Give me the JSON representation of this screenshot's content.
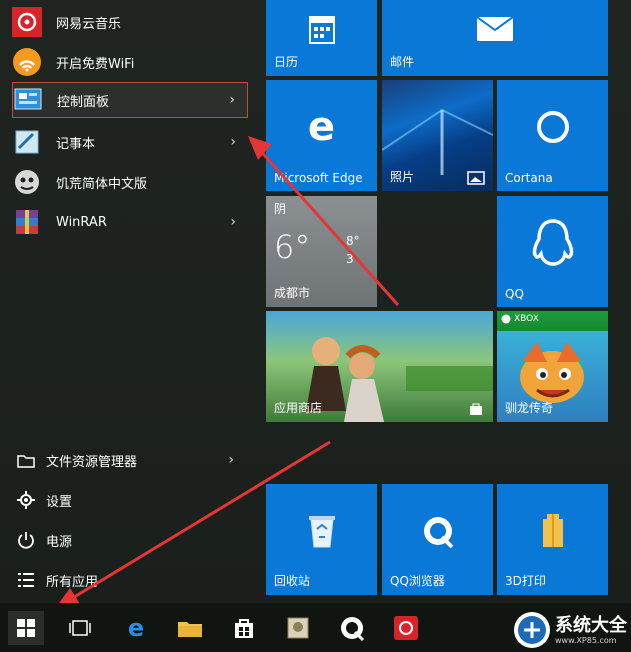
{
  "apps": [
    {
      "label": "网易云音乐",
      "icon": "netease-music-icon"
    },
    {
      "label": "开启免费WiFi",
      "icon": "free-wifi-icon"
    },
    {
      "label": "控制面板",
      "icon": "control-panel-icon"
    },
    {
      "label": "记事本",
      "icon": "notepad-icon"
    },
    {
      "label": "饥荒简体中文版",
      "icon": "dont-starve-icon"
    },
    {
      "label": "WinRAR",
      "icon": "winrar-icon"
    }
  ],
  "system": [
    {
      "label": "文件资源管理器",
      "icon": "file-explorer-icon"
    },
    {
      "label": "设置",
      "icon": "gear-icon"
    },
    {
      "label": "电源",
      "icon": "power-icon"
    },
    {
      "label": "所有应用",
      "icon": "all-apps-icon"
    }
  ],
  "tiles": {
    "calendar": "日历",
    "mail": "邮件",
    "edge": "Microsoft Edge",
    "photos": "照片",
    "cortana": "Cortana",
    "weather": {
      "condition": "阴",
      "temp": "6°",
      "high": "8°",
      "low": "3",
      "city": "成都市"
    },
    "qq": "QQ",
    "store": "应用商店",
    "xbox_badge": "XBOX",
    "xbox_game": "驯龙传奇",
    "recycle": "回收站",
    "qq_browser": "QQ浏览器",
    "builder3d": "3D打印"
  },
  "watermark": {
    "text": "系统大全",
    "url": "www.XP85.com"
  },
  "colors": {
    "tile": "#0a78d7",
    "highlight": "#c84848",
    "arrow": "#e53535"
  }
}
